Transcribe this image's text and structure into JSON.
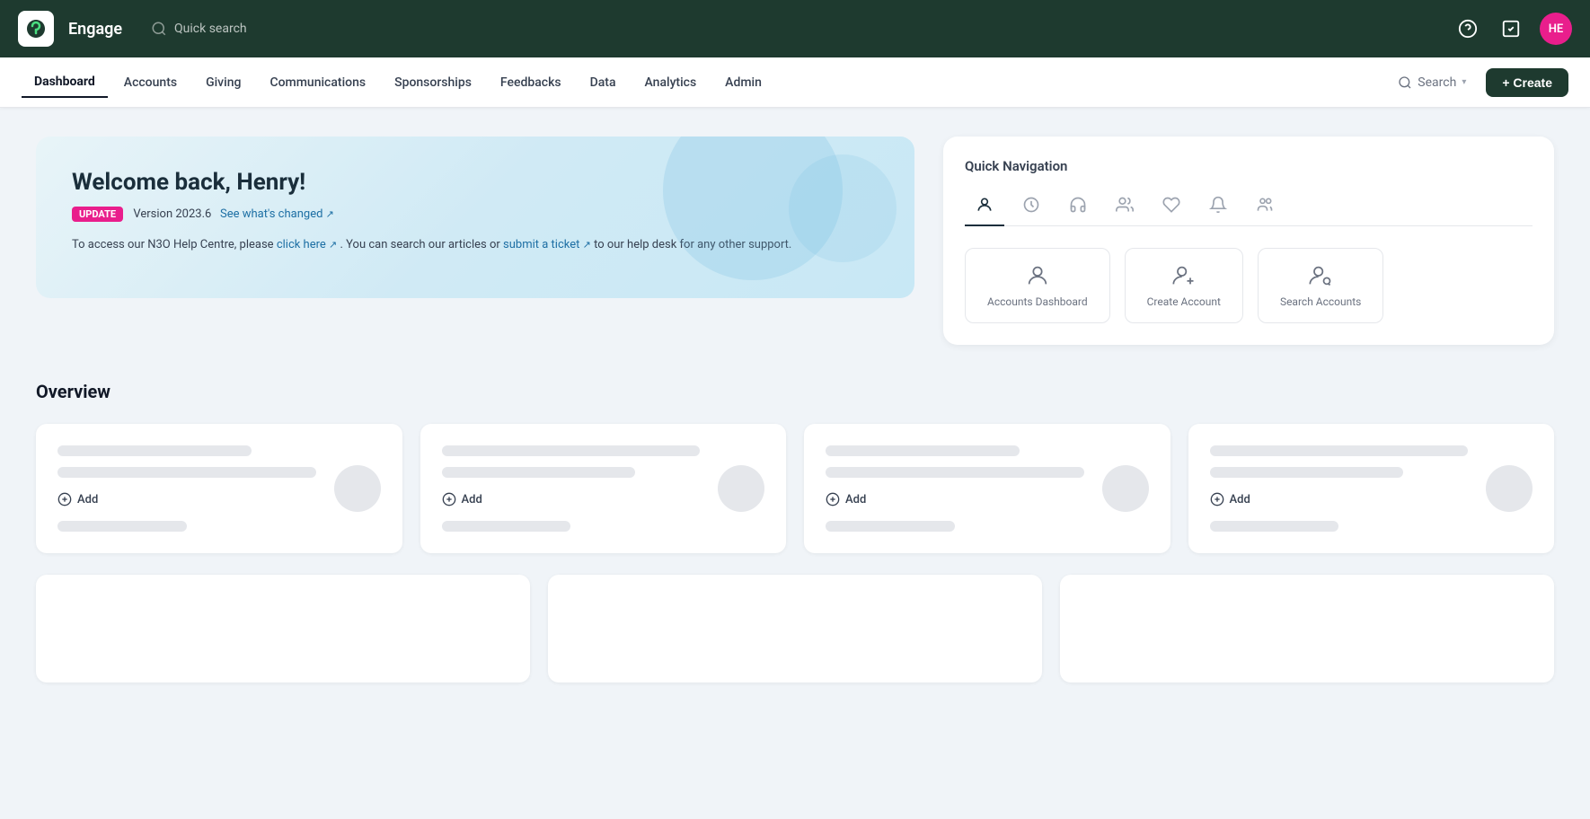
{
  "app": {
    "name": "Engage",
    "logo_alt": "Engage logo"
  },
  "topbar": {
    "quick_search_placeholder": "Quick search",
    "help_icon": "help-circle-icon",
    "tasks_icon": "tasks-icon",
    "avatar_initials": "HE",
    "avatar_bg": "#e91e8c"
  },
  "subnav": {
    "items": [
      {
        "label": "Dashboard",
        "active": true
      },
      {
        "label": "Accounts",
        "active": false
      },
      {
        "label": "Giving",
        "active": false
      },
      {
        "label": "Communications",
        "active": false
      },
      {
        "label": "Sponsorships",
        "active": false
      },
      {
        "label": "Feedbacks",
        "active": false
      },
      {
        "label": "Data",
        "active": false
      },
      {
        "label": "Analytics",
        "active": false
      },
      {
        "label": "Admin",
        "active": false
      }
    ],
    "search_label": "Search",
    "create_label": "+ Create"
  },
  "welcome": {
    "title": "Welcome back, Henry!",
    "badge": "UPDATE",
    "version": "Version 2023.6",
    "see_whats_changed": "See what's changed",
    "help_text_1": "To access our N3O Help Centre, please",
    "click_here": "click here",
    "help_text_2": ". You can search our articles or",
    "submit_ticket": "submit a ticket",
    "help_text_3": "to our help desk for any other support."
  },
  "quick_nav": {
    "title": "Quick Navigation",
    "tabs": [
      {
        "icon": "person-icon",
        "active": true
      },
      {
        "icon": "clock-icon",
        "active": false
      },
      {
        "icon": "headset-icon",
        "active": false
      },
      {
        "icon": "people-icon",
        "active": false
      },
      {
        "icon": "heart-icon",
        "active": false
      },
      {
        "icon": "bell-icon",
        "active": false
      },
      {
        "icon": "group-icon",
        "active": false
      }
    ],
    "items": [
      {
        "label": "Accounts Dashboard",
        "icon": "person-icon"
      },
      {
        "label": "Create Account",
        "icon": "person-plus-icon"
      },
      {
        "label": "Search Accounts",
        "icon": "person-search-icon"
      }
    ]
  },
  "overview": {
    "title": "Overview",
    "cards": [
      {
        "add_label": "Add"
      },
      {
        "add_label": "Add"
      },
      {
        "add_label": "Add"
      },
      {
        "add_label": "Add"
      }
    ],
    "bottom_cards": [
      {},
      {},
      {}
    ]
  }
}
